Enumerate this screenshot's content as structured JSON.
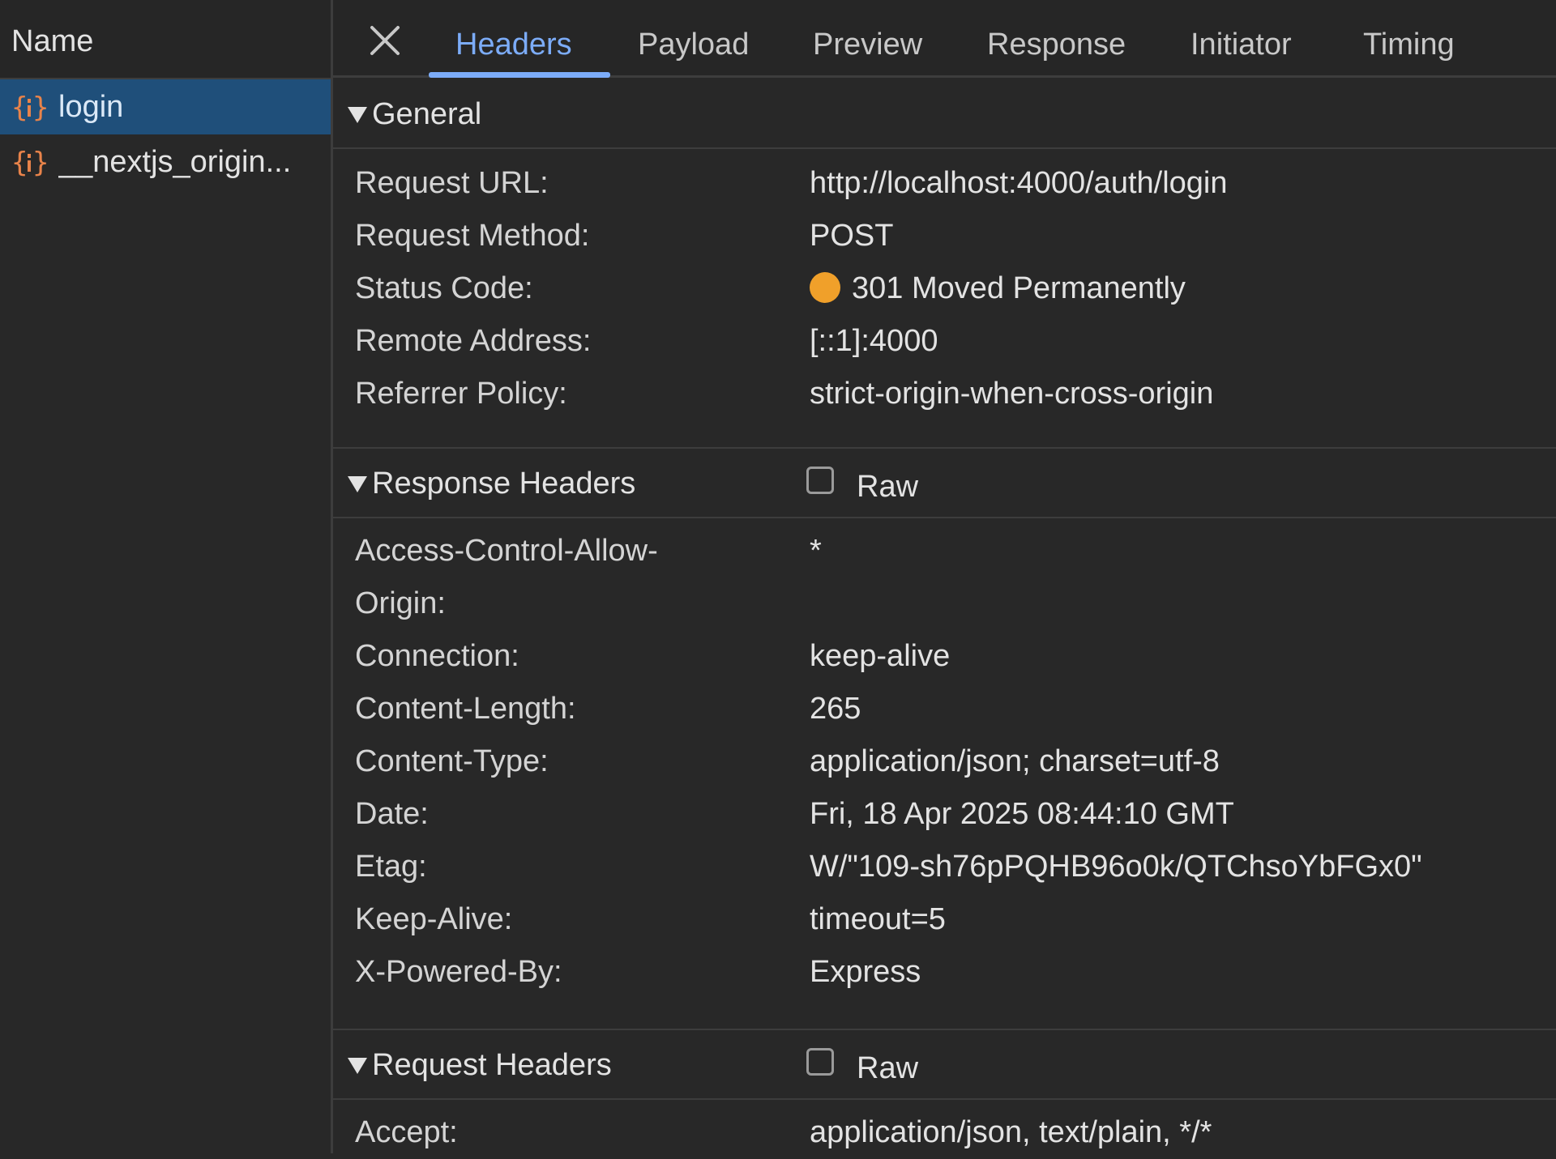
{
  "request_list": {
    "header": "Name",
    "items": [
      {
        "name": "login",
        "selected": true
      },
      {
        "name": "__nextjs_origin...",
        "selected": false
      }
    ]
  },
  "tabs": [
    {
      "label": "Headers",
      "active": true
    },
    {
      "label": "Payload",
      "active": false
    },
    {
      "label": "Preview",
      "active": false
    },
    {
      "label": "Response",
      "active": false
    },
    {
      "label": "Initiator",
      "active": false
    },
    {
      "label": "Timing",
      "active": false
    }
  ],
  "general": {
    "title": "General",
    "rows": [
      {
        "key": "Request URL:",
        "value": "http://localhost:4000/auth/login"
      },
      {
        "key": "Request Method:",
        "value": "POST"
      },
      {
        "key": "Status Code:",
        "value": "301 Moved Permanently"
      },
      {
        "key": "Remote Address:",
        "value": "[::1]:4000"
      },
      {
        "key": "Referrer Policy:",
        "value": "strict-origin-when-cross-origin"
      }
    ]
  },
  "response_headers": {
    "title": "Response Headers",
    "raw_label": "Raw",
    "raw_checked": false,
    "rows": [
      {
        "key": "Access-Control-Allow-Origin:",
        "value": "*"
      },
      {
        "key": "Connection:",
        "value": "keep-alive"
      },
      {
        "key": "Content-Length:",
        "value": "265"
      },
      {
        "key": "Content-Type:",
        "value": "application/json; charset=utf-8"
      },
      {
        "key": "Date:",
        "value": "Fri, 18 Apr 2025 08:44:10 GMT"
      },
      {
        "key": "Etag:",
        "value": "W/\"109-sh76pPQHB96o0k/QTChsoYbFGx0\""
      },
      {
        "key": "Keep-Alive:",
        "value": "timeout=5"
      },
      {
        "key": "X-Powered-By:",
        "value": "Express"
      }
    ]
  },
  "request_headers": {
    "title": "Request Headers",
    "raw_label": "Raw",
    "raw_checked": false,
    "rows": [
      {
        "key": "Accept:",
        "value": "application/json, text/plain, */*"
      }
    ]
  },
  "colors": {
    "accent": "#7cacf8",
    "selected_row": "#1f4f7a",
    "status_dot": "#f0a02a",
    "fetch_icon": "#e8834a"
  },
  "icons": {
    "close": "close-icon",
    "fetch": "fetch-braces-icon",
    "collapse": "triangle-down-icon"
  }
}
